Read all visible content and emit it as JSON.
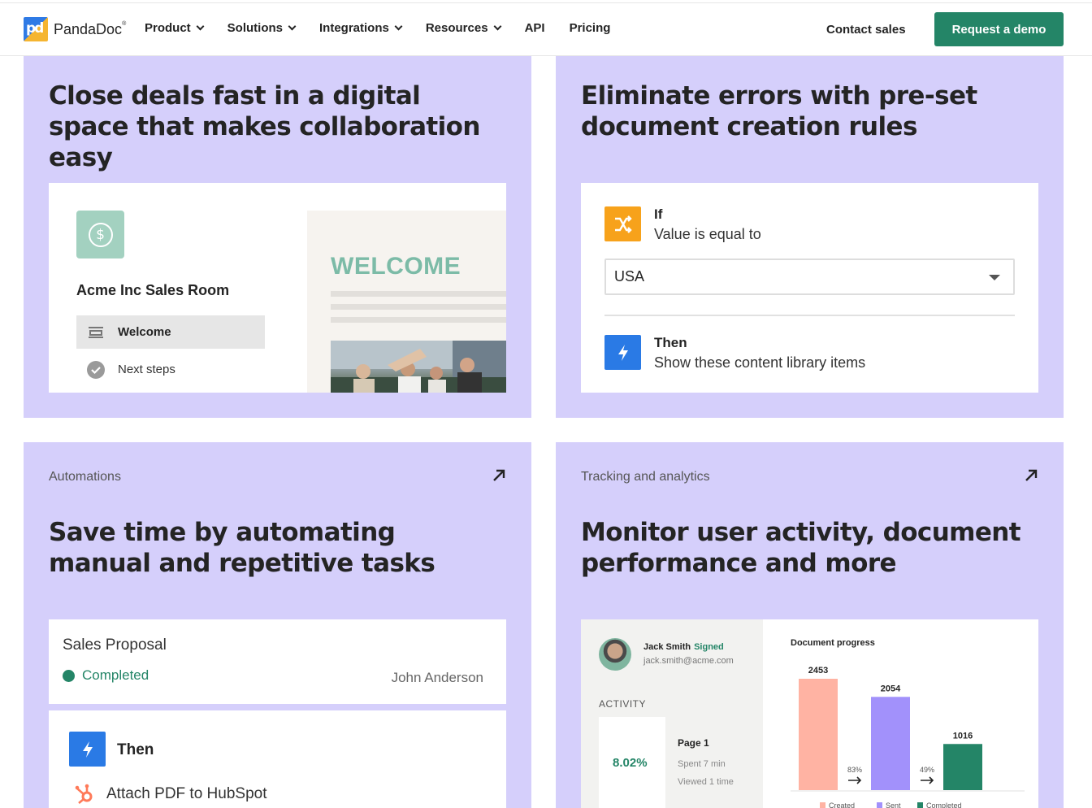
{
  "header": {
    "brand": "PandaDoc",
    "nav": [
      "Product",
      "Solutions",
      "Integrations",
      "Resources",
      "API",
      "Pricing"
    ],
    "contact_label": "Contact sales",
    "demo_label": "Request a demo"
  },
  "card1": {
    "title": "Close deals fast in a digital space that makes collaboration easy",
    "room_title": "Acme Inc Sales Room",
    "items": [
      "Welcome",
      "Next steps"
    ],
    "preview_heading": "WELCOME"
  },
  "card2": {
    "title": "Eliminate errors with pre-set document creation rules",
    "if_label": "If",
    "if_condition": "Value is equal to",
    "select_value": "USA",
    "then_label": "Then",
    "then_action": "Show these content library items"
  },
  "card3": {
    "eyebrow": "Automations",
    "title": "Save time by automating manual and repetitive tasks",
    "doc_title": "Sales Proposal",
    "status": "Completed",
    "assignee": "John Anderson",
    "then_label": "Then",
    "action": "Attach PDF to HubSpot"
  },
  "card4": {
    "eyebrow": "Tracking and analytics",
    "title": "Monitor user activity, document performance and more",
    "user_name": "Jack Smith",
    "user_status": "Signed",
    "user_email": "jack.smith@acme.com",
    "activity_label": "ACTIVITY",
    "percent": "8.02%",
    "page_label": "Page 1",
    "spent": "Spent 7 min",
    "viewed": "Viewed 1 time",
    "chart_title": "Document progress"
  },
  "chart_data": {
    "type": "bar",
    "title": "Document progress",
    "categories": [
      "Created",
      "Sent",
      "Completed"
    ],
    "values": [
      2453,
      2054,
      1016
    ],
    "conversion_labels": [
      "83%",
      "49%"
    ],
    "colors": [
      "#ffb3a3",
      "#a291fb",
      "#248567"
    ]
  },
  "colors": {
    "card_bg": "#d5cffb",
    "accent_green": "#248567",
    "accent_orange": "#f7a21b",
    "accent_blue": "#2a7ae5"
  }
}
